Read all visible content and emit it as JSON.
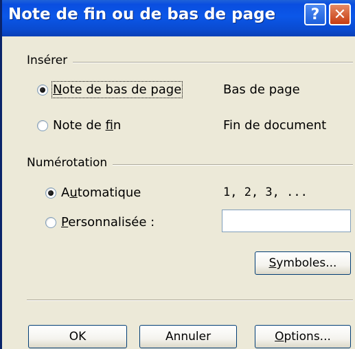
{
  "window": {
    "title": "Note de fin ou de bas de page",
    "help_icon": "?",
    "close_icon": "✕"
  },
  "insert_group": {
    "label": "Insérer",
    "options": [
      {
        "pre": "",
        "mnemonic": "N",
        "post": "ote de bas de page",
        "value": "Bas de page",
        "checked": true
      },
      {
        "pre": "Note de ",
        "mnemonic": "f",
        "post": "in",
        "value": "Fin de document",
        "checked": false
      }
    ]
  },
  "numbering_group": {
    "label": "Numérotation",
    "options": [
      {
        "pre": "A",
        "mnemonic": "u",
        "post": "tomatique",
        "value": "1, 2, 3, ...",
        "checked": true
      },
      {
        "pre": "",
        "mnemonic": "P",
        "post": "ersonnalisée :",
        "value": "",
        "checked": false
      }
    ],
    "custom_input_value": ""
  },
  "buttons": {
    "symbols": {
      "mnemonic": "S",
      "rest": "ymboles..."
    },
    "ok": "OK",
    "cancel": "Annuler",
    "options": {
      "mnemonic": "O",
      "rest": "ptions..."
    }
  },
  "colors": {
    "titlebar": "#0b57e8",
    "dialog_bg": "#ece9d8",
    "close_button": "#c73c10"
  }
}
